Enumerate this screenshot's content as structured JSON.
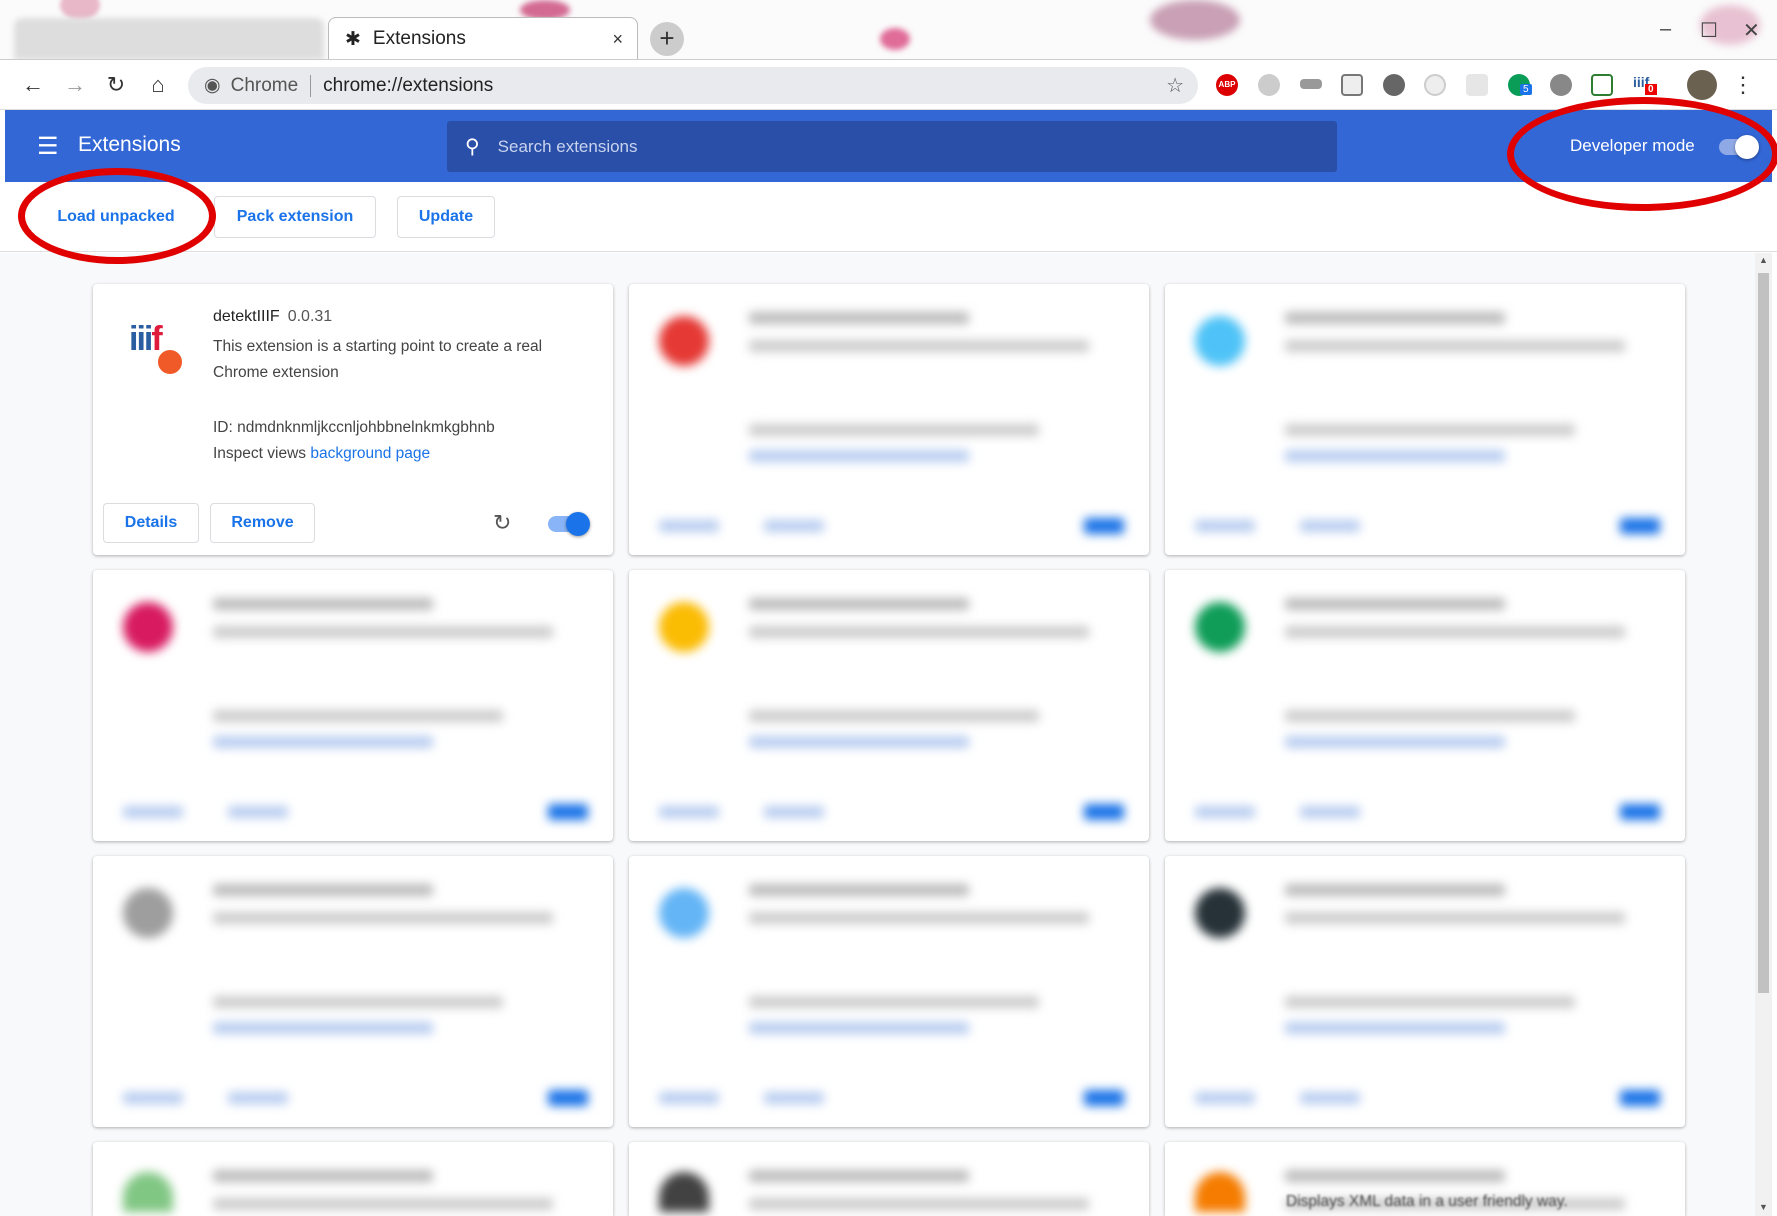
{
  "browser": {
    "tab_title": "Extensions",
    "new_tab": "+",
    "tab_close": "×",
    "omnibox": {
      "site_label": "Chrome",
      "url": "chrome://extensions"
    },
    "extension_badges": {
      "green": "5",
      "iiif": "0"
    },
    "icons": [
      "back-icon",
      "forward-icon",
      "reload-icon",
      "home-icon",
      "star-icon",
      "abp-icon",
      "xml-icon",
      "image-icon",
      "react-icon",
      "profile-avatar",
      "more-icon"
    ]
  },
  "header": {
    "title": "Extensions",
    "search_placeholder": "Search extensions",
    "developer_mode_label": "Developer mode",
    "developer_mode_on": true,
    "accent": "#3367d6"
  },
  "actions": {
    "load_unpacked": "Load unpacked",
    "pack_extension": "Pack extension",
    "update": "Update"
  },
  "extension": {
    "name": "detektIIIF",
    "version": "0.0.31",
    "description": "This extension is a starting point to create a real Chrome extension",
    "id": "ID: ndmdnknmljkccnljohbbnelnkmkgbhnb",
    "inspect_label": "Inspect views",
    "inspect_link": "background page",
    "details": "Details",
    "remove": "Remove",
    "enabled": true
  },
  "partial_text": "Displays XML data in a user friendly way.",
  "annotation_color": "#e00000"
}
